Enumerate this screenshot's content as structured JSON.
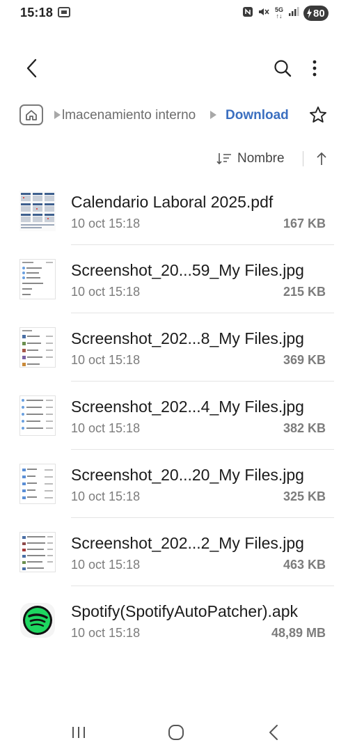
{
  "status_bar": {
    "time": "15:18",
    "network": "5G",
    "battery": "80",
    "icons": [
      "screenshot-notification-icon",
      "nfc-icon",
      "mute-icon",
      "signal-icon",
      "battery-charging-icon"
    ]
  },
  "top_bar": {
    "icons": [
      "back-arrow-icon",
      "search-icon",
      "more-options-icon"
    ]
  },
  "breadcrumb": {
    "items": [
      "lmacenamiento interno",
      "Download"
    ],
    "active_color": "#3b6fc0"
  },
  "sort": {
    "label": "Nombre"
  },
  "files": [
    {
      "name": "Calendario Laboral 2025.pdf",
      "date": "10 oct 15:18",
      "size": "167 KB",
      "thumb": "pdf-calendar"
    },
    {
      "name": "Screenshot_20...59_My Files.jpg",
      "date": "10 oct 15:18",
      "size": "215 KB",
      "thumb": "screenshot"
    },
    {
      "name": "Screenshot_202...8_My Files.jpg",
      "date": "10 oct 15:18",
      "size": "369 KB",
      "thumb": "screenshot"
    },
    {
      "name": "Screenshot_202...4_My Files.jpg",
      "date": "10 oct 15:18",
      "size": "382 KB",
      "thumb": "screenshot"
    },
    {
      "name": "Screenshot_20...20_My Files.jpg",
      "date": "10 oct 15:18",
      "size": "325 KB",
      "thumb": "screenshot"
    },
    {
      "name": "Screenshot_202...2_My Files.jpg",
      "date": "10 oct 15:18",
      "size": "463 KB",
      "thumb": "screenshot"
    },
    {
      "name": "Spotify(SpotifyAutoPatcher).apk",
      "date": "10 oct 15:18",
      "size": "48,89 MB",
      "thumb": "spotify-app-icon"
    }
  ],
  "nav_bar": {
    "icons": [
      "recent-apps-icon",
      "home-icon",
      "back-icon"
    ]
  }
}
